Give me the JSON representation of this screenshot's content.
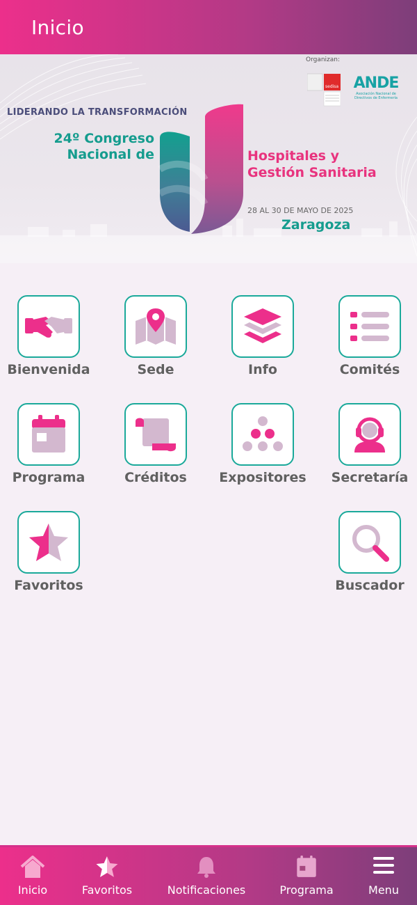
{
  "header": {
    "title": "Inicio"
  },
  "banner": {
    "organizan": "Organizan:",
    "sedisa": "sedisa",
    "ande": "ANDE",
    "ande_sub": "Asociación Nacional de Directivos de Enfermería",
    "tagline": "LIDERANDO LA TRANSFORMACIÓN",
    "congreso": "24º Congreso Nacional de",
    "tema": "Hospitales y Gestión Sanitaria",
    "fechas": "28 AL 30 DE MAYO DE 2025",
    "ciudad": "Zaragoza"
  },
  "menu": {
    "items": [
      {
        "label": "Bienvenida",
        "icon": "handshake-icon"
      },
      {
        "label": "Sede",
        "icon": "map-icon"
      },
      {
        "label": "Info",
        "icon": "layers-icon"
      },
      {
        "label": "Comités",
        "icon": "list-icon"
      },
      {
        "label": "Programa",
        "icon": "calendar-icon"
      },
      {
        "label": "Créditos",
        "icon": "scroll-icon"
      },
      {
        "label": "Expositores",
        "icon": "dots-pyramid-icon"
      },
      {
        "label": "Secretaría",
        "icon": "headset-icon"
      },
      {
        "label": "Favoritos",
        "icon": "star-icon"
      },
      {
        "label": "Buscador",
        "icon": "search-icon"
      }
    ]
  },
  "tabbar": {
    "tabs": [
      {
        "label": "Inicio",
        "icon": "home-icon"
      },
      {
        "label": "Favoritos",
        "icon": "star-icon"
      },
      {
        "label": "Notificaciones",
        "icon": "bell-icon"
      },
      {
        "label": "Programa",
        "icon": "calendar-icon"
      },
      {
        "label": "Menu",
        "icon": "hamburger-icon"
      }
    ]
  },
  "colors": {
    "accent": "#ec2f8b",
    "teal": "#1aa99a",
    "icon_light": "#d3b8cf"
  }
}
